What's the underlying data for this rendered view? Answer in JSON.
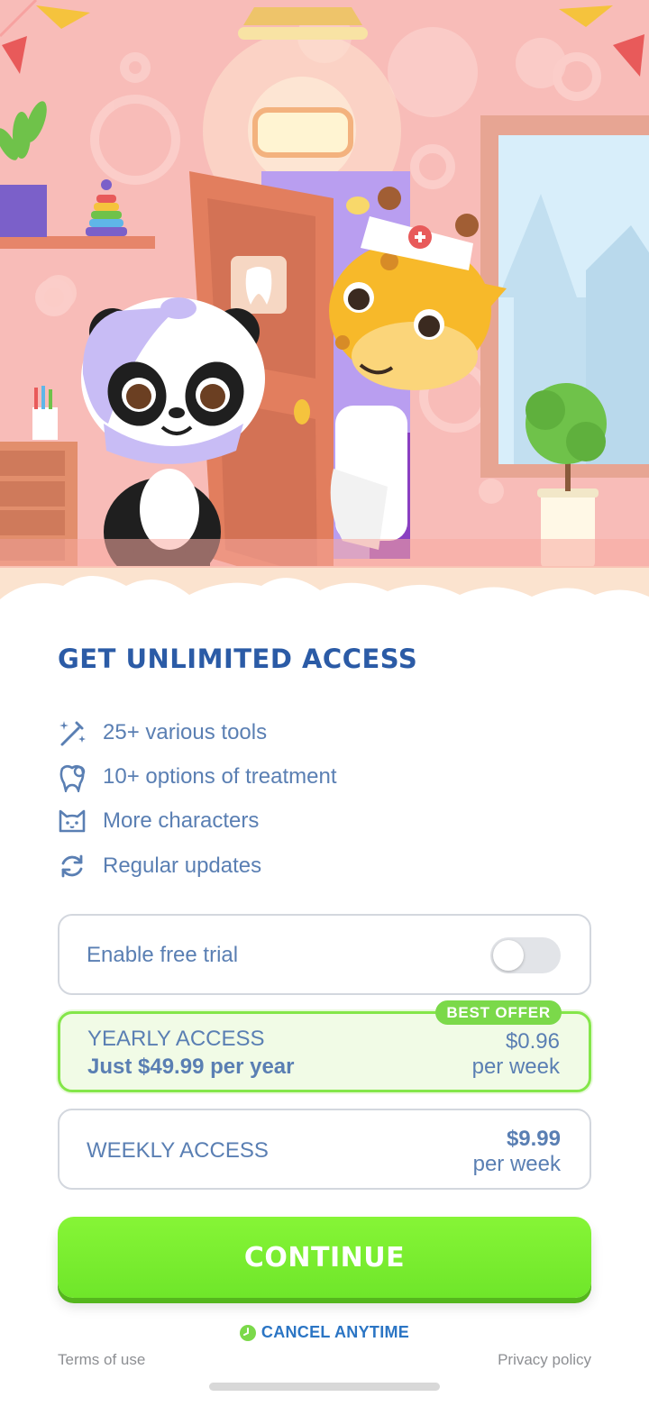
{
  "paywall": {
    "title": "GET UNLIMITED ACCESS",
    "features": [
      {
        "icon": "magic-wand-icon",
        "label": "25+ various tools"
      },
      {
        "icon": "tooth-icon",
        "label": "10+ options of treatment"
      },
      {
        "icon": "cat-face-icon",
        "label": "More characters"
      },
      {
        "icon": "refresh-icon",
        "label": "Regular updates"
      }
    ],
    "trial": {
      "label": "Enable free trial",
      "enabled": false
    },
    "yearly": {
      "badge": "BEST OFFER",
      "name": "YEARLY ACCESS",
      "subtitle": "Just $49.99 per year",
      "price": "$0.96",
      "unit": "per week"
    },
    "weekly": {
      "name": "WEEKLY ACCESS",
      "price": "$9.99",
      "unit": "per week"
    },
    "continue_label": "CONTINUE",
    "cancel_label": "CANCEL ANYTIME",
    "terms_label": "Terms of use",
    "privacy_label": "Privacy policy"
  },
  "colors": {
    "accent_green": "#7bd94a",
    "title_blue": "#2b5ba6",
    "text_blue": "#5a7fb3",
    "wall_pink": "#f7b9b6"
  }
}
